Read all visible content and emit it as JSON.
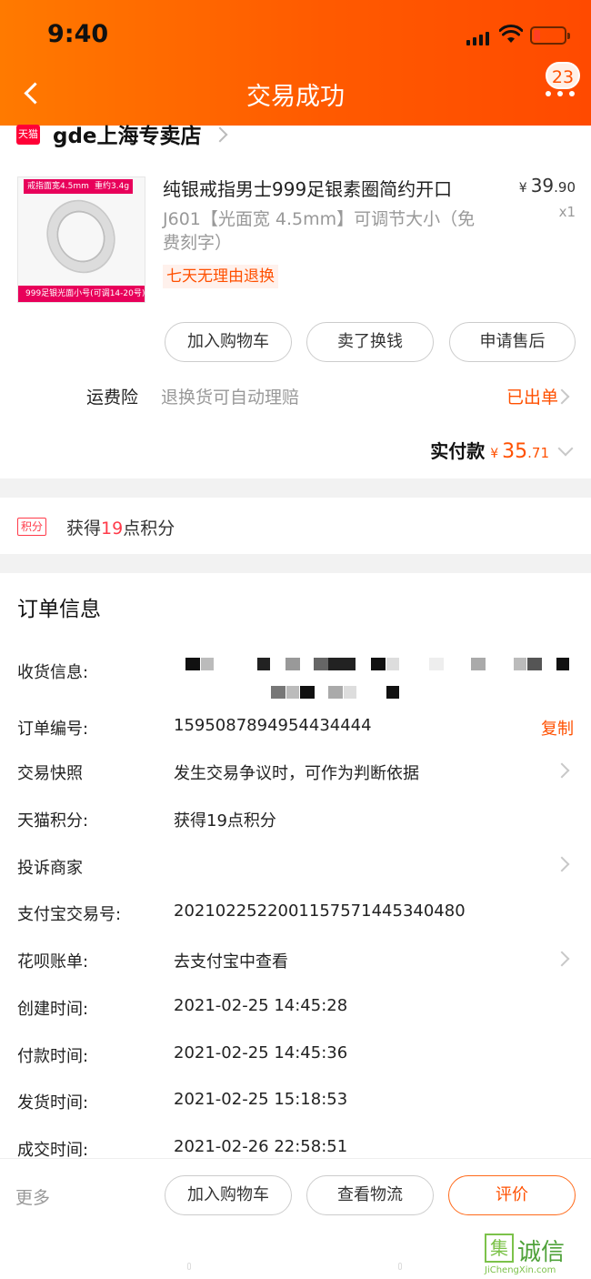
{
  "status_bar": {
    "time": "9:40"
  },
  "header": {
    "title": "交易成功",
    "message_count": "23"
  },
  "store": {
    "badge": "天猫",
    "name": "gde上海专卖店"
  },
  "product": {
    "image_tag_left": "戒指面宽4.5mm",
    "image_tag_right": "重约3.4g",
    "image_bottom_tag": "999足银光面小号(可调14-20号)",
    "title": "纯银戒指男士999足银素圈简约开口",
    "sku": "J601【光面宽 4.5mm】可调节大小（免费刻字）",
    "service_tag": "七天无理由退换",
    "price_currency": "¥",
    "price_int": "39",
    "price_dec": ".90",
    "quantity": "x1"
  },
  "actions": {
    "add_cart": "加入购物车",
    "sell": "卖了换钱",
    "after_sale": "申请售后"
  },
  "insurance": {
    "label": "运费险",
    "desc": "退换货可自动理赔",
    "status": "已出单"
  },
  "payment": {
    "label": "实付款",
    "currency": "¥",
    "amount_int": "35",
    "amount_dec": ".71"
  },
  "points": {
    "tag": "积分",
    "prefix": "获得",
    "value": "19",
    "suffix": "点积分"
  },
  "order": {
    "title": "订单信息",
    "receiver_label": "收货信息:",
    "order_no_label": "订单编号:",
    "order_no": "1595087894954434444",
    "copy": "复制",
    "snapshot_label": "交易快照",
    "snapshot_value": "发生交易争议时，可作为判断依据",
    "tmall_points_label": "天猫积分:",
    "tmall_points_value": "获得19点积分",
    "complaint_label": "投诉商家",
    "alipay_no_label": "支付宝交易号:",
    "alipay_no": "2021022522001157571445340480",
    "huabei_label": "花呗账单:",
    "huabei_value": "去支付宝中查看",
    "created_label": "创建时间:",
    "created_time": "2021-02-25 14:45:28",
    "paid_label": "付款时间:",
    "paid_time": "2021-02-25 14:45:36",
    "shipped_label": "发货时间:",
    "shipped_time": "2021-02-25 15:18:53",
    "completed_label": "成交时间:",
    "completed_time": "2021-02-26 22:58:51"
  },
  "footer": {
    "more": "更多",
    "add_cart": "加入购物车",
    "logistics": "查看物流",
    "review": "评价"
  },
  "watermark": {
    "icon_char": "集",
    "text": "诚信",
    "url": "JiChengXin.com"
  },
  "colors": {
    "accent": "#ff5000",
    "header_start": "#ff7a00",
    "header_end": "#ff4a00",
    "tmall_red": "#ff0036"
  }
}
